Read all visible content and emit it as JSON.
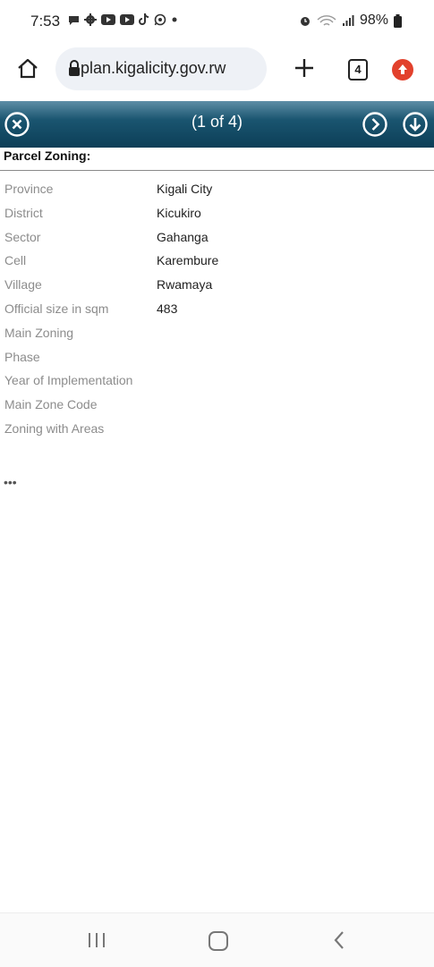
{
  "status": {
    "time": "7:53",
    "battery": "98%",
    "icons_left": [
      "chat-icon",
      "gear-icon",
      "youtube-icon",
      "youtube-icon",
      "tiktok-icon",
      "whatsapp-icon",
      "dot-icon"
    ],
    "icons_right": [
      "alarm-icon",
      "wifi-icon",
      "signal-icon",
      "battery-icon"
    ]
  },
  "browser": {
    "url": "plan.kigalicity.gov.rw",
    "tab_count": "4",
    "upload_color": "#e2412c"
  },
  "popup": {
    "page_count": "(1 of 4)",
    "header_color": "#0c3e57"
  },
  "section": {
    "title": "Parcel Zoning:"
  },
  "attributes": [
    {
      "key": "Province",
      "value": "Kigali City"
    },
    {
      "key": "District",
      "value": "Kicukiro"
    },
    {
      "key": "Sector",
      "value": "Gahanga"
    },
    {
      "key": "Cell",
      "value": "Karembure"
    },
    {
      "key": "Village",
      "value": "Rwamaya"
    },
    {
      "key": "Official size in sqm",
      "value": "483"
    },
    {
      "key": "Main Zoning",
      "value": ""
    },
    {
      "key": "Phase",
      "value": ""
    },
    {
      "key": "Year of Implementation",
      "value": ""
    },
    {
      "key": "Main Zone Code",
      "value": ""
    },
    {
      "key": "Zoning with Areas",
      "value": ""
    }
  ],
  "more_label": "•••"
}
